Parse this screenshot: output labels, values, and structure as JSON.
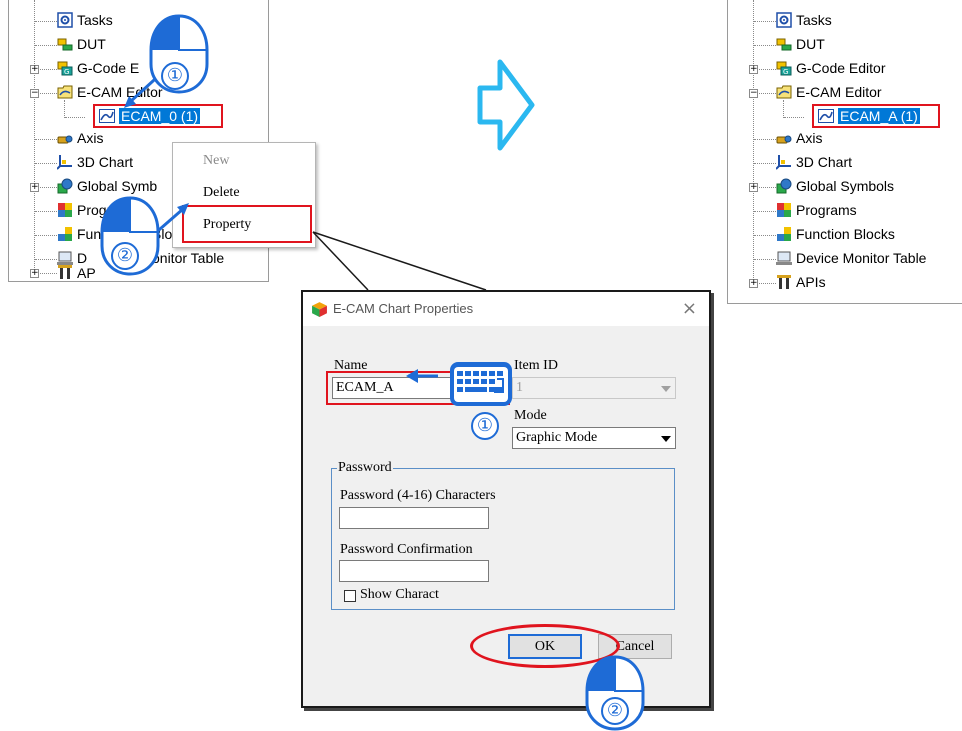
{
  "left_tree": {
    "items": [
      {
        "label": "Tasks",
        "icon": "tasks-icon"
      },
      {
        "label": "DUT",
        "icon": "dut-icon"
      },
      {
        "label": "G-Code E",
        "icon": "gcode-editor-icon",
        "expander": "+"
      },
      {
        "label": "E-CAM Editor",
        "icon": "ecam-editor-icon",
        "expander": "−"
      },
      {
        "label": "ECAM_0 (1)",
        "icon": "ecam-chart-icon",
        "selected": true
      },
      {
        "label": "Axis",
        "icon": "axis-icon"
      },
      {
        "label": "3D Chart",
        "icon": "3d-chart-icon"
      },
      {
        "label": "Global Symb",
        "icon": "global-symbols-icon",
        "expander": "+"
      },
      {
        "label": "Programs",
        "icon": "programs-icon"
      },
      {
        "label": "Fun",
        "label_tail": "Blo",
        "icon": "function-blocks-icon"
      },
      {
        "label": "D",
        "label_tail": "onitor Table",
        "icon": "device-monitor-icon"
      },
      {
        "label": "AP",
        "icon": "apis-icon",
        "expander": "+"
      }
    ]
  },
  "context_menu": {
    "items": [
      {
        "label": "New",
        "disabled": true
      },
      {
        "label": "Delete"
      },
      {
        "label": "Property",
        "highlighted": true
      }
    ]
  },
  "step_markers": {
    "one": "①",
    "two": "②"
  },
  "dialog": {
    "title": "E-CAM Chart Properties",
    "close": "×",
    "name_label": "Name",
    "name_value": "ECAM_A",
    "item_id_label": "Item ID",
    "item_id_value": "1",
    "mode_label": "Mode",
    "mode_value": "Graphic Mode",
    "password_group": "Password",
    "password_label": "Password (4-16) Characters",
    "password_value": "",
    "confirm_label": "Password Confirmation",
    "confirm_value": "",
    "show_chars_label": "Show Charact",
    "ok_label": "OK",
    "cancel_label": "Cancel"
  },
  "right_tree": {
    "items": [
      {
        "label": "Tasks",
        "icon": "tasks-icon"
      },
      {
        "label": "DUT",
        "icon": "dut-icon"
      },
      {
        "label": "G-Code Editor",
        "icon": "gcode-editor-icon",
        "expander": "+"
      },
      {
        "label": "E-CAM Editor",
        "icon": "ecam-editor-icon",
        "expander": "−"
      },
      {
        "label": "ECAM_A (1)",
        "icon": "ecam-chart-icon",
        "selected": true
      },
      {
        "label": "Axis",
        "icon": "axis-icon"
      },
      {
        "label": "3D Chart",
        "icon": "3d-chart-icon"
      },
      {
        "label": "Global Symbols",
        "icon": "global-symbols-icon",
        "expander": "+"
      },
      {
        "label": "Programs",
        "icon": "programs-icon"
      },
      {
        "label": "Function Blocks",
        "icon": "function-blocks-icon"
      },
      {
        "label": "Device Monitor Table",
        "icon": "device-monitor-icon"
      },
      {
        "label": "APIs",
        "icon": "apis-icon",
        "expander": "+"
      }
    ]
  },
  "colors": {
    "highlight_red": "#e0141e",
    "selection_blue": "#0078d7",
    "annotation_blue": "#1e6bd6",
    "arrow_cyan": "#33ccff"
  }
}
